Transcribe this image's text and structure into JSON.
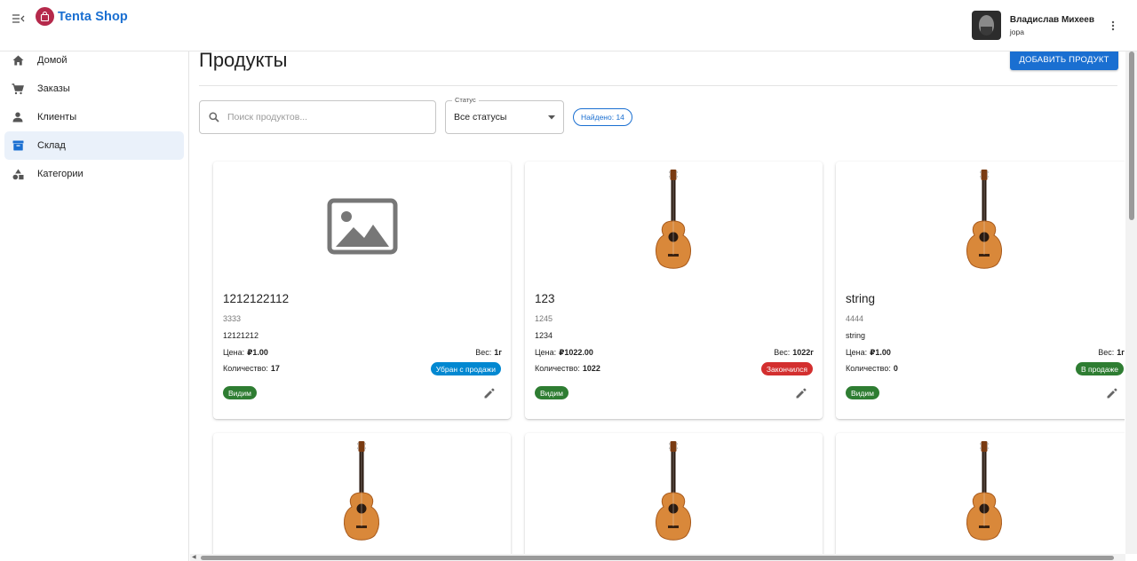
{
  "app": {
    "title": "Tenta Shop"
  },
  "user": {
    "name": "Владислав Михеев",
    "login": "jopa"
  },
  "sidebar": {
    "items": [
      {
        "label": "Домой",
        "icon": "home-icon",
        "active": false
      },
      {
        "label": "Заказы",
        "icon": "cart-icon",
        "active": false
      },
      {
        "label": "Клиенты",
        "icon": "person-icon",
        "active": false
      },
      {
        "label": "Склад",
        "icon": "warehouse-icon",
        "active": true
      },
      {
        "label": "Категории",
        "icon": "category-icon",
        "active": false
      }
    ]
  },
  "page": {
    "title": "Продукты",
    "add_button": "ДОБАВИТЬ ПРОДУКТ"
  },
  "filters": {
    "search_placeholder": "Поиск продуктов...",
    "status_label": "Статус",
    "status_value": "Все статусы",
    "found": "Найдено: 14"
  },
  "labels": {
    "price": "Цена:",
    "weight": "Вес:",
    "quantity": "Количество:"
  },
  "products": [
    {
      "title": "1212122112",
      "code": "3333",
      "description": "12121212",
      "price": "₽1.00",
      "weight": "1г",
      "quantity": "17",
      "status": "Убран с продажи",
      "status_color": "#0288d1",
      "visibility": "Видим",
      "image": "placeholder-image"
    },
    {
      "title": "123",
      "code": "1245",
      "description": "1234",
      "price": "₽1022.00",
      "weight": "1022г",
      "quantity": "1022",
      "status": "Закончился",
      "status_color": "#d32f2f",
      "visibility": "Видим",
      "image": "guitar"
    },
    {
      "title": "string",
      "code": "4444",
      "description": "string",
      "price": "₽1.00",
      "weight": "1г",
      "quantity": "0",
      "status": "В продаже",
      "status_color": "#2e7d32",
      "visibility": "Видим",
      "image": "guitar"
    }
  ],
  "colors": {
    "primary": "#1a6fd1",
    "visible": "#2e7d32",
    "logo": "#b5294b"
  }
}
